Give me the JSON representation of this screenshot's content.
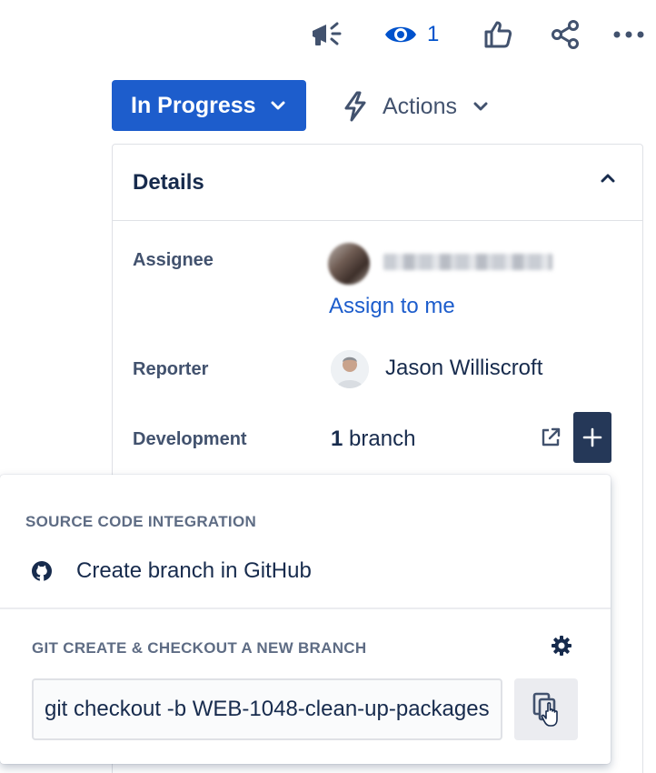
{
  "toolbar": {
    "watch_count": "1"
  },
  "status": {
    "label": "In Progress"
  },
  "actions": {
    "label": "Actions"
  },
  "details": {
    "title": "Details",
    "assignee": {
      "label": "Assignee",
      "assign_to_me": "Assign to me"
    },
    "reporter": {
      "label": "Reporter",
      "name": "Jason Williscroft"
    },
    "development": {
      "label": "Development",
      "count": "1",
      "unit": "branch"
    }
  },
  "popup": {
    "source_heading": "SOURCE CODE INTEGRATION",
    "create_branch_label": "Create branch in GitHub",
    "git_heading": "GIT CREATE & CHECKOUT A NEW BRANCH",
    "git_command": "git checkout -b WEB-1048-clean-up-packages"
  },
  "icons": {
    "announce": "megaphone-icon",
    "watch": "eye-icon",
    "like": "thumbs-up-icon",
    "share": "share-icon",
    "more": "more-icon",
    "actions": "lightning-icon",
    "github": "github-icon",
    "settings": "gear-icon",
    "copy": "copy-icon",
    "open": "external-link-icon",
    "add": "plus-icon"
  },
  "colors": {
    "primary": "#1d5dcc",
    "dark": "#253858",
    "text": "#172b4d",
    "subtle": "#42526e"
  }
}
